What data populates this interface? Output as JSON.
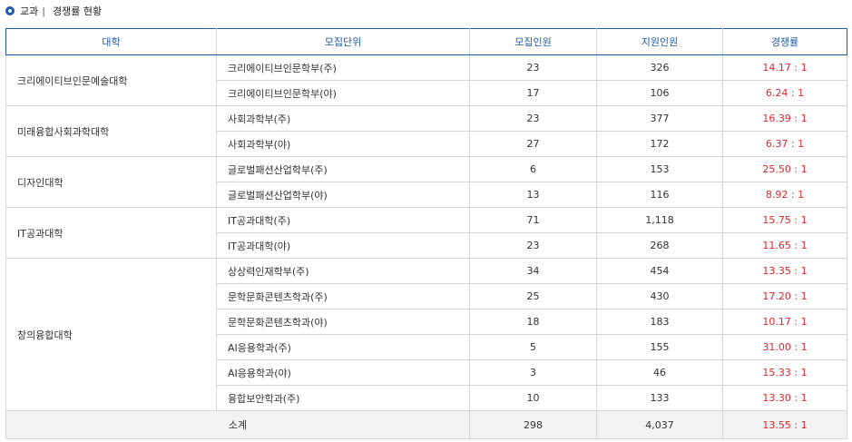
{
  "title": {
    "prefix": "교과",
    "separator": "|",
    "text": "경쟁률 현황"
  },
  "colors": {
    "accent": "#1f5ca8",
    "ratio": "#e0262b",
    "total_bg": "#f2f2f2"
  },
  "table": {
    "headers": [
      "대학",
      "모집단위",
      "모집인원",
      "지원인원",
      "경쟁률"
    ],
    "groups": [
      {
        "college": "크리에이티브인문예술대학",
        "rows": [
          {
            "unit": "크리에이티브인문학부(주)",
            "quota": "23",
            "applicants": "326",
            "ratio": "14.17 : 1"
          },
          {
            "unit": "크리에이티브인문학부(야)",
            "quota": "17",
            "applicants": "106",
            "ratio": "6.24 : 1"
          }
        ]
      },
      {
        "college": "미래융합사회과학대학",
        "rows": [
          {
            "unit": "사회과학부(주)",
            "quota": "23",
            "applicants": "377",
            "ratio": "16.39 : 1"
          },
          {
            "unit": "사회과학부(야)",
            "quota": "27",
            "applicants": "172",
            "ratio": "6.37 : 1"
          }
        ]
      },
      {
        "college": "디자인대학",
        "rows": [
          {
            "unit": "글로벌패션산업학부(주)",
            "quota": "6",
            "applicants": "153",
            "ratio": "25.50 : 1"
          },
          {
            "unit": "글로벌패션산업학부(야)",
            "quota": "13",
            "applicants": "116",
            "ratio": "8.92 : 1"
          }
        ]
      },
      {
        "college": "IT공과대학",
        "rows": [
          {
            "unit": "IT공과대학(주)",
            "quota": "71",
            "applicants": "1,118",
            "ratio": "15.75 : 1"
          },
          {
            "unit": "IT공과대학(야)",
            "quota": "23",
            "applicants": "268",
            "ratio": "11.65 : 1"
          }
        ]
      },
      {
        "college": "창의융합대학",
        "rows": [
          {
            "unit": "상상력인재학부(주)",
            "quota": "34",
            "applicants": "454",
            "ratio": "13.35 : 1"
          },
          {
            "unit": "문학문화콘텐츠학과(주)",
            "quota": "25",
            "applicants": "430",
            "ratio": "17.20 : 1"
          },
          {
            "unit": "문학문화콘텐츠학과(야)",
            "quota": "18",
            "applicants": "183",
            "ratio": "10.17 : 1"
          },
          {
            "unit": "AI응용학과(주)",
            "quota": "5",
            "applicants": "155",
            "ratio": "31.00 : 1"
          },
          {
            "unit": "AI응용학과(야)",
            "quota": "3",
            "applicants": "46",
            "ratio": "15.33 : 1"
          },
          {
            "unit": "융합보안학과(주)",
            "quota": "10",
            "applicants": "133",
            "ratio": "13.30 : 1"
          }
        ]
      }
    ],
    "total": {
      "label": "소계",
      "quota": "298",
      "applicants": "4,037",
      "ratio": "13.55 : 1"
    }
  }
}
